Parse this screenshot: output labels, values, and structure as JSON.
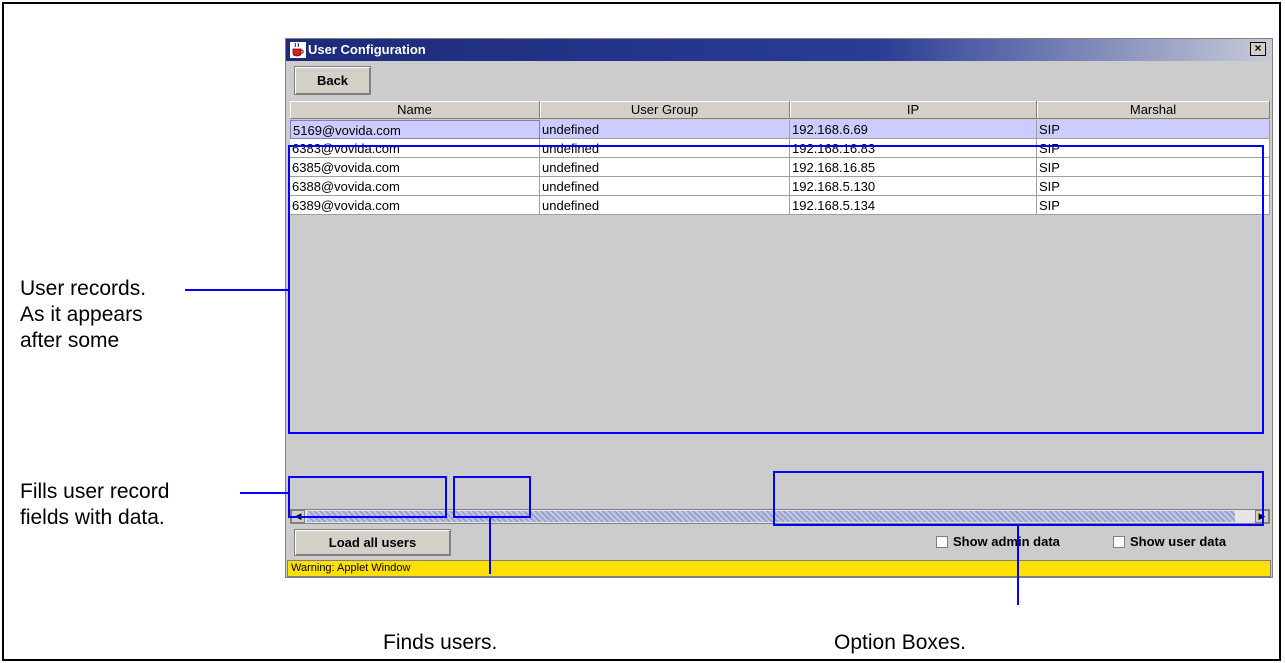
{
  "window": {
    "title": "User Configuration",
    "close_glyph": "×",
    "back_label": "Back",
    "load_all_label": "Load all users",
    "show_admin_label": "Show admin data",
    "show_admin_checked": false,
    "show_user_label": "Show user data",
    "show_user_checked": false,
    "warning": "Warning: Applet Window"
  },
  "table": {
    "columns": [
      "Name",
      "User Group",
      "IP",
      "Marshal"
    ],
    "rows": [
      [
        "5169@vovida.com",
        "undefined",
        "192.168.6.69",
        "SIP"
      ],
      [
        "6383@vovida.com",
        "undefined",
        "192.168.16.83",
        "SIP"
      ],
      [
        "6385@vovida.com",
        "undefined",
        "192.168.16.85",
        "SIP"
      ],
      [
        "6388@vovida.com",
        "undefined",
        "192.168.5.130",
        "SIP"
      ],
      [
        "6389@vovida.com",
        "undefined",
        "192.168.5.134",
        "SIP"
      ]
    ],
    "selected_row": 0
  },
  "annotations": {
    "records_line1": "User records.",
    "records_line2": "As it appears",
    "records_line3": "after some",
    "fills_line1": "Fills user record",
    "fills_line2": "fields with data.",
    "finds": "Finds users.",
    "options": "Option Boxes."
  },
  "colors": {
    "highlight": "#0000ff",
    "selected_row": "#ccccff",
    "warning_bar": "#ffe000"
  }
}
